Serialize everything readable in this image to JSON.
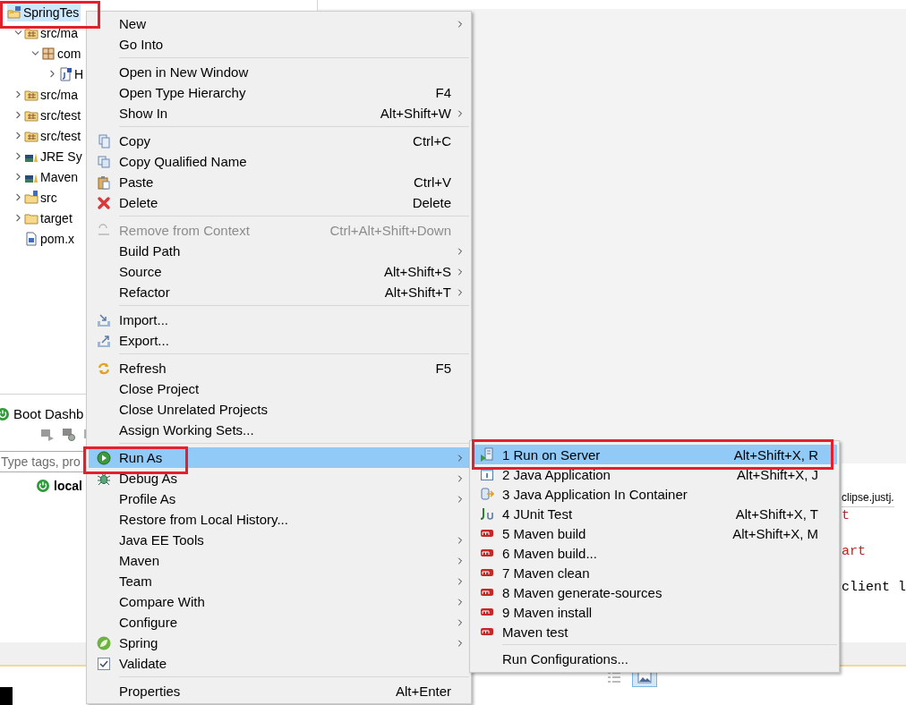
{
  "explorer": {
    "items": [
      {
        "label": "SpringTes",
        "kind": "project",
        "selected": true,
        "annotated": true,
        "children": [
          {
            "label": "src/ma",
            "kind": "source-folder",
            "expanded": true,
            "selected": false,
            "children": [
              {
                "label": "com",
                "kind": "package",
                "expanded": true,
                "selected": false,
                "children": [
                  {
                    "label": "H",
                    "kind": "java-file",
                    "expanded": false,
                    "selected": false
                  }
                ]
              }
            ]
          },
          {
            "label": "src/ma",
            "kind": "source-folder",
            "expanded": false,
            "selected": false
          },
          {
            "label": "src/test",
            "kind": "source-folder",
            "expanded": false,
            "selected": false
          },
          {
            "label": "src/test",
            "kind": "source-folder",
            "expanded": false,
            "selected": false
          },
          {
            "label": "JRE Sy",
            "kind": "library",
            "expanded": false,
            "selected": false
          },
          {
            "label": "Maven",
            "kind": "library",
            "expanded": false,
            "selected": false
          },
          {
            "label": "src",
            "kind": "spring-folder",
            "expanded": false,
            "selected": false
          },
          {
            "label": "target",
            "kind": "folder",
            "expanded": false,
            "selected": false
          },
          {
            "label": "pom.x",
            "kind": "xml-file",
            "selected": false
          }
        ]
      }
    ]
  },
  "boot_dashboard": {
    "tab": "Boot Dashb",
    "search": {
      "placeholder": "Type tags, pro"
    },
    "targets": [
      {
        "label": "local"
      }
    ]
  },
  "console": {
    "path": "clipse.justj.",
    "lines": [
      {
        "text": "t",
        "color": "#c8201f"
      },
      {
        "text": "art",
        "color": "#c8201f"
      },
      {
        "text": "client l",
        "color": "#000000"
      }
    ]
  },
  "console_toolbar": [
    {
      "selected": false
    },
    {
      "selected": true
    }
  ],
  "context_menu": {
    "items": [
      {
        "kind": "command",
        "label": "New",
        "submenu": true,
        "disabled": false,
        "selected": false
      },
      {
        "kind": "command",
        "label": "Go Into",
        "submenu": false,
        "disabled": false,
        "selected": false
      },
      {
        "kind": "separator"
      },
      {
        "kind": "command",
        "label": "Open in New Window",
        "submenu": false,
        "disabled": false,
        "selected": false
      },
      {
        "kind": "command",
        "label": "Open Type Hierarchy",
        "shortcut": "F4",
        "submenu": false,
        "disabled": false,
        "selected": false
      },
      {
        "kind": "command",
        "label": "Show In",
        "shortcut": "Alt+Shift+W",
        "submenu": true,
        "disabled": false,
        "selected": false
      },
      {
        "kind": "separator"
      },
      {
        "kind": "command",
        "label": "Copy",
        "shortcut": "Ctrl+C",
        "submenu": false,
        "disabled": false,
        "selected": false
      },
      {
        "kind": "command",
        "label": "Copy Qualified Name",
        "submenu": false,
        "disabled": false,
        "selected": false
      },
      {
        "kind": "command",
        "label": "Paste",
        "shortcut": "Ctrl+V",
        "submenu": false,
        "disabled": false,
        "selected": false
      },
      {
        "kind": "command",
        "label": "Delete",
        "shortcut": "Delete",
        "submenu": false,
        "disabled": false,
        "selected": false
      },
      {
        "kind": "separator"
      },
      {
        "kind": "command",
        "label": "Remove from Context",
        "shortcut": "Ctrl+Alt+Shift+Down",
        "submenu": false,
        "disabled": true,
        "selected": false
      },
      {
        "kind": "command",
        "label": "Build Path",
        "submenu": true,
        "disabled": false,
        "selected": false
      },
      {
        "kind": "command",
        "label": "Source",
        "shortcut": "Alt+Shift+S",
        "submenu": true,
        "disabled": false,
        "selected": false
      },
      {
        "kind": "command",
        "label": "Refactor",
        "shortcut": "Alt+Shift+T",
        "submenu": true,
        "disabled": false,
        "selected": false
      },
      {
        "kind": "separator"
      },
      {
        "kind": "command",
        "label": "Import...",
        "submenu": false,
        "disabled": false,
        "selected": false
      },
      {
        "kind": "command",
        "label": "Export...",
        "submenu": false,
        "disabled": false,
        "selected": false
      },
      {
        "kind": "separator"
      },
      {
        "kind": "command",
        "label": "Refresh",
        "shortcut": "F5",
        "submenu": false,
        "disabled": false,
        "selected": false
      },
      {
        "kind": "command",
        "label": "Close Project",
        "submenu": false,
        "disabled": false,
        "selected": false
      },
      {
        "kind": "command",
        "label": "Close Unrelated Projects",
        "submenu": false,
        "disabled": false,
        "selected": false
      },
      {
        "kind": "command",
        "label": "Assign Working Sets...",
        "submenu": false,
        "disabled": false,
        "selected": false
      },
      {
        "kind": "separator"
      },
      {
        "kind": "command",
        "label": "Run As",
        "submenu": true,
        "disabled": false,
        "selected": true,
        "annotated": true
      },
      {
        "kind": "command",
        "label": "Debug As",
        "submenu": true,
        "disabled": false,
        "selected": false
      },
      {
        "kind": "command",
        "label": "Profile As",
        "submenu": true,
        "disabled": false,
        "selected": false
      },
      {
        "kind": "command",
        "label": "Restore from Local History...",
        "submenu": false,
        "disabled": false,
        "selected": false
      },
      {
        "kind": "command",
        "label": "Java EE Tools",
        "submenu": true,
        "disabled": false,
        "selected": false
      },
      {
        "kind": "command",
        "label": "Maven",
        "submenu": true,
        "disabled": false,
        "selected": false
      },
      {
        "kind": "command",
        "label": "Team",
        "submenu": true,
        "disabled": false,
        "selected": false
      },
      {
        "kind": "command",
        "label": "Compare With",
        "submenu": true,
        "disabled": false,
        "selected": false
      },
      {
        "kind": "command",
        "label": "Configure",
        "submenu": true,
        "disabled": false,
        "selected": false
      },
      {
        "kind": "command",
        "label": "Spring",
        "submenu": true,
        "disabled": false,
        "selected": false
      },
      {
        "kind": "command",
        "label": "Validate",
        "submenu": false,
        "disabled": false,
        "selected": false
      },
      {
        "kind": "separator"
      },
      {
        "kind": "command",
        "label": "Properties",
        "shortcut": "Alt+Enter",
        "submenu": false,
        "disabled": false,
        "selected": false
      }
    ]
  },
  "run_as_submenu": {
    "items": [
      {
        "kind": "command",
        "label": "1 Run on Server",
        "shortcut": "Alt+Shift+X, R",
        "selected": true,
        "annotated": true
      },
      {
        "kind": "command",
        "label": "2 Java Application",
        "shortcut": "Alt+Shift+X, J",
        "selected": false
      },
      {
        "kind": "command",
        "label": "3 Java Application In Container",
        "selected": false
      },
      {
        "kind": "command",
        "label": "4 JUnit Test",
        "shortcut": "Alt+Shift+X, T",
        "selected": false
      },
      {
        "kind": "command",
        "label": "5 Maven build",
        "shortcut": "Alt+Shift+X, M",
        "selected": false
      },
      {
        "kind": "command",
        "label": "6 Maven build...",
        "selected": false
      },
      {
        "kind": "command",
        "label": "7 Maven clean",
        "selected": false
      },
      {
        "kind": "command",
        "label": "8 Maven generate-sources",
        "selected": false
      },
      {
        "kind": "command",
        "label": "9 Maven install",
        "selected": false
      },
      {
        "kind": "command",
        "label": "Maven test",
        "selected": false
      },
      {
        "kind": "separator"
      },
      {
        "kind": "command",
        "label": "Run Configurations...",
        "selected": false
      }
    ]
  }
}
